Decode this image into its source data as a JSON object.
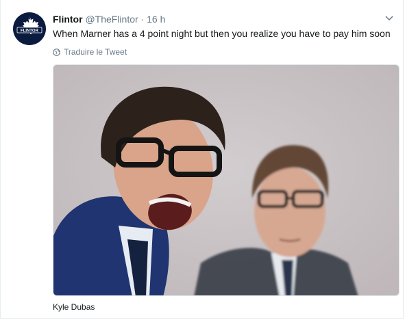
{
  "tweet": {
    "author_name": "Flintor",
    "author_handle": "@TheFlintor",
    "separator": "·",
    "time": "16 h",
    "text": "When Marner has a 4 point night but then you realize you have to pay him soon",
    "translate_label": "Traduire le Tweet",
    "media_caption": "Kyle Dubas",
    "avatar_text": "FLINTOR"
  },
  "icons": {
    "caret": "chevron-down-icon",
    "translate": "globe-icon",
    "avatar_mark": "maple-leaf-icon"
  },
  "colors": {
    "text": "#14171a",
    "secondary": "#657786",
    "avatar_bg": "#0b1b3f"
  }
}
